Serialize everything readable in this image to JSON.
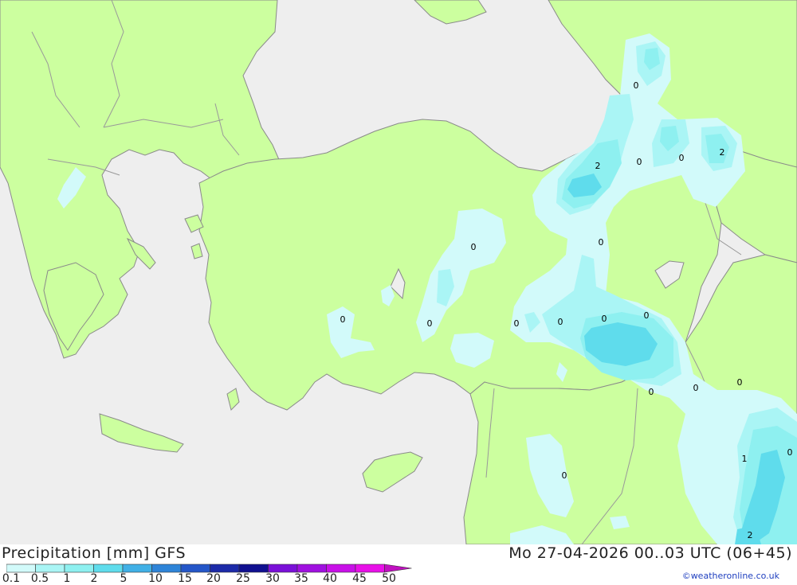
{
  "header": {
    "title": "Precipitation [mm] GFS",
    "datetime": "Mo 27-04-2026 00..03 UTC (06+45)"
  },
  "footer": {
    "credit": "©weatheronline.co.uk"
  },
  "colors": {
    "sea": "#eeeeee",
    "land": "#ccff9f",
    "border": "#999999"
  },
  "legend": {
    "ticks": [
      "0.1",
      "0.5",
      "1",
      "2",
      "5",
      "10",
      "15",
      "20",
      "25",
      "30",
      "35",
      "40",
      "45",
      "50"
    ],
    "swatches": [
      "#d2fafa",
      "#aaf5f5",
      "#8ef0f0",
      "#5fdcec",
      "#41b0e6",
      "#2e84d8",
      "#2456c8",
      "#1c2aa8",
      "#101090",
      "#7a10d8",
      "#a010e0",
      "#c810e8",
      "#e810e8",
      "#c010c0"
    ]
  },
  "map_labels": [
    "0",
    "2",
    "0",
    "0",
    "2",
    "0",
    "0",
    "0",
    "0",
    "0",
    "0",
    "0",
    "0",
    "0",
    "0",
    "0",
    "1",
    "0",
    "0",
    "2"
  ]
}
